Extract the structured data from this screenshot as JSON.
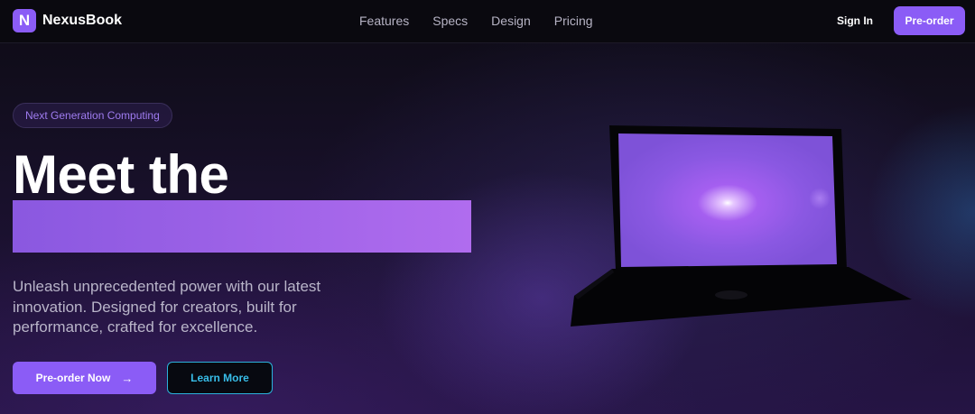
{
  "header": {
    "logo_letter": "N",
    "brand": "NexusBook",
    "nav": [
      "Features",
      "Specs",
      "Design",
      "Pricing"
    ],
    "sign_in": "Sign In",
    "preorder": "Pre-order"
  },
  "hero": {
    "badge": "Next Generation Computing",
    "headline": "Meet the",
    "description": "Unleash unprecedented power with our latest innovation. Designed for creators, built for performance, crafted for excellence.",
    "cta_primary": "Pre-order Now",
    "cta_primary_icon": "arrow-right-icon",
    "cta_secondary": "Learn More"
  },
  "colors": {
    "accent": "#8b5cf6",
    "secondary_accent": "#38bde8",
    "background": "#0b0a12"
  }
}
